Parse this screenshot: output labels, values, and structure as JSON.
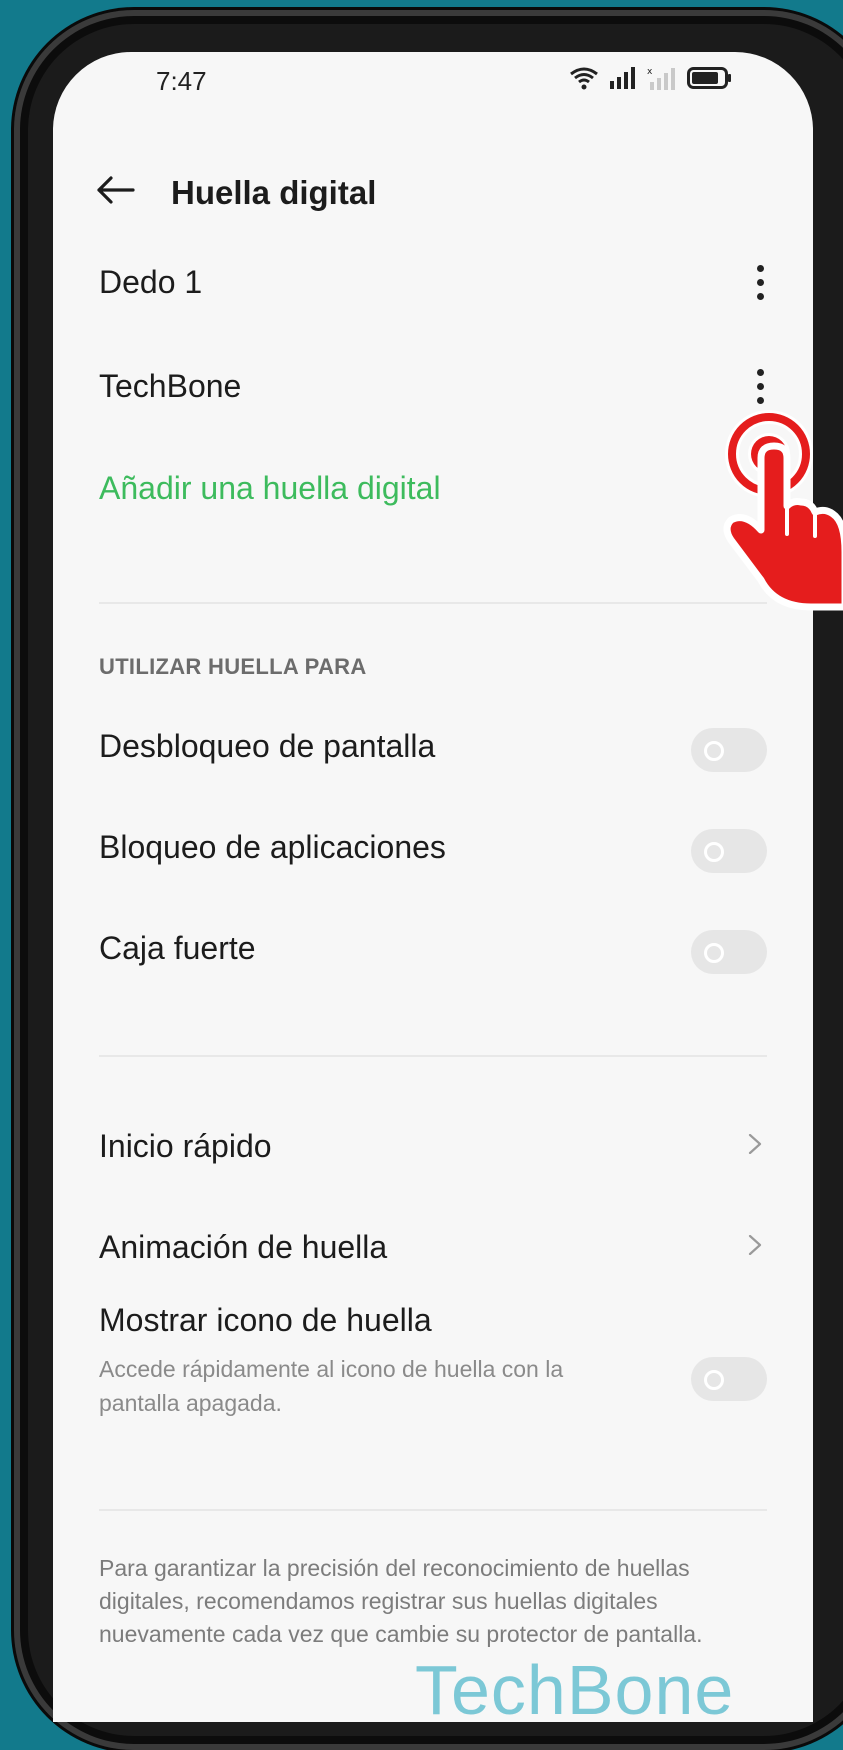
{
  "status_bar": {
    "time": "7:47",
    "icons": [
      "wifi-icon",
      "signal-icon",
      "signal-empty-icon",
      "battery-icon"
    ]
  },
  "header": {
    "title": "Huella digital",
    "back_icon": "arrow-left-icon"
  },
  "fingerprints": [
    {
      "label": "Dedo 1",
      "menu_icon": "more-vertical-icon"
    },
    {
      "label": "TechBone",
      "menu_icon": "more-vertical-icon"
    }
  ],
  "add_fingerprint": {
    "label": "Añadir una huella digital",
    "color": "#3dbb5d"
  },
  "use_section": {
    "heading": "UTILIZAR HUELLA PARA",
    "items": [
      {
        "label": "Desbloqueo de pantalla",
        "enabled": false
      },
      {
        "label": "Bloqueo de aplicaciones",
        "enabled": false
      },
      {
        "label": "Caja fuerte",
        "enabled": false
      }
    ]
  },
  "more_section": {
    "items": [
      {
        "label": "Inicio rápido",
        "icon": "chevron-right-icon"
      },
      {
        "label": "Animación de huella",
        "icon": "chevron-right-icon"
      }
    ],
    "show_icon": {
      "label": "Mostrar icono de huella",
      "description": "Accede rápidamente al icono de huella con la pantalla apagada.",
      "enabled": false
    }
  },
  "footnote": "Para garantizar la precisión del reconocimiento de huellas digitales, recomendamos registrar sus huellas digitales nuevamente cada vez que cambie su protector de pantalla.",
  "watermark": "TechBone",
  "colors": {
    "background": "#127a8c",
    "screen": "#f7f7f7",
    "accent": "#3dbb5d",
    "hand": "#e51d1d"
  }
}
